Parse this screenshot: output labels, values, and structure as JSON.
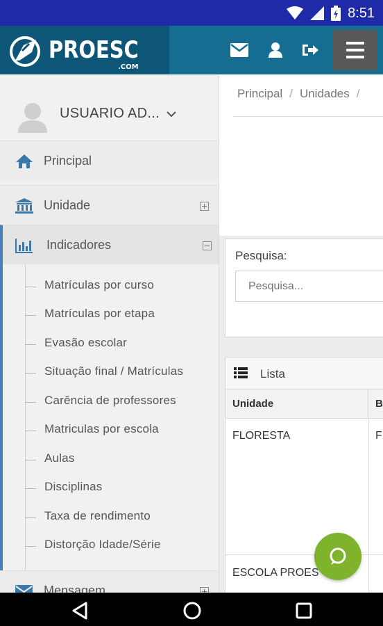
{
  "status_bar": {
    "time": "8:51"
  },
  "header": {
    "logo_text": "PROESC",
    "logo_sub": ".COM"
  },
  "sidebar": {
    "user_name": "USUARIO AD...",
    "menu": [
      {
        "label": "Principal",
        "icon": "home-icon"
      },
      {
        "label": "Unidade",
        "icon": "bank-icon",
        "toggle": "expand"
      },
      {
        "label": "Indicadores",
        "icon": "bar-chart-icon",
        "toggle": "collapse"
      },
      {
        "label": "Mensagem",
        "icon": "envelope-icon",
        "toggle": "expand"
      }
    ],
    "submenu": [
      "Matrículas por curso",
      "Matrículas por etapa",
      "Evasão escolar",
      "Situação final / Matrículas",
      "Carência de professores",
      "Matriculas por escola",
      "Aulas",
      "Disciplinas",
      "Taxa de rendimento",
      "Distorção Idade/Série"
    ]
  },
  "main": {
    "breadcrumb": [
      "Principal",
      "Unidades"
    ],
    "search": {
      "label": "Pesquisa:",
      "placeholder": "Pesquisa..."
    },
    "list": {
      "title": "Lista",
      "columns": [
        "Unidade",
        "Ba"
      ],
      "rows": [
        [
          "FLORESTA",
          "F"
        ],
        [
          "ESCOLA PROES",
          ""
        ]
      ]
    }
  },
  "colors": {
    "status_bar": "#1f2aa8",
    "header": "#156d91",
    "logo_bg": "#0e5677",
    "accent": "#4a7fb8",
    "chat": "#7fb32c"
  }
}
